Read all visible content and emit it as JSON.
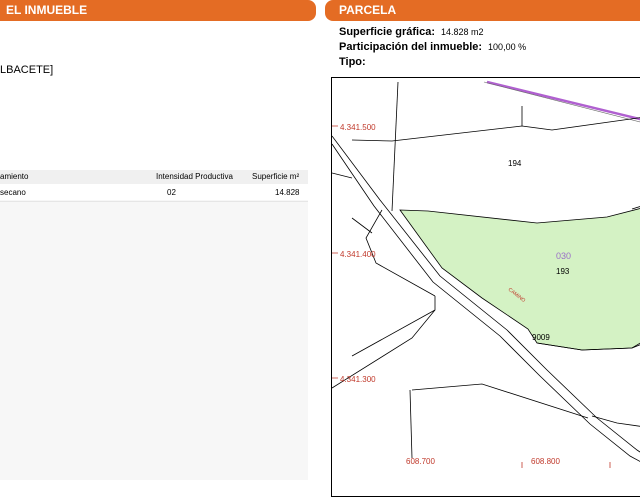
{
  "left_panel": {
    "header": "EL INMUEBLE",
    "location": "LBACETE]",
    "table": {
      "columns": [
        "amiento",
        "Intensidad Productiva",
        "Superficie m²"
      ],
      "rows": [
        [
          "secano",
          "02",
          "14.828"
        ]
      ]
    }
  },
  "right_panel": {
    "header": "PARCELA",
    "superficie_label": "Superficie gráfica:",
    "superficie_value": "14.828 m2",
    "participacion_label": "Participación del inmueble:",
    "participacion_value": "100,00 %",
    "tipo_label": "Tipo:"
  },
  "map": {
    "coords": {
      "y1": "4.341.500",
      "y2": "4.341.400",
      "y3": "4.341.300",
      "x1": "608.700",
      "x2": "608.800"
    },
    "parcel_labels": {
      "p194": "194",
      "p030": "030",
      "p193": "193",
      "p9009": "9009",
      "camino": "CAMINO"
    },
    "colors": {
      "highlight_fill": "#d4f2c4",
      "boundary_purple": "#b060d0",
      "coord_red": "#c0392b",
      "header_orange": "#e46c24"
    }
  }
}
